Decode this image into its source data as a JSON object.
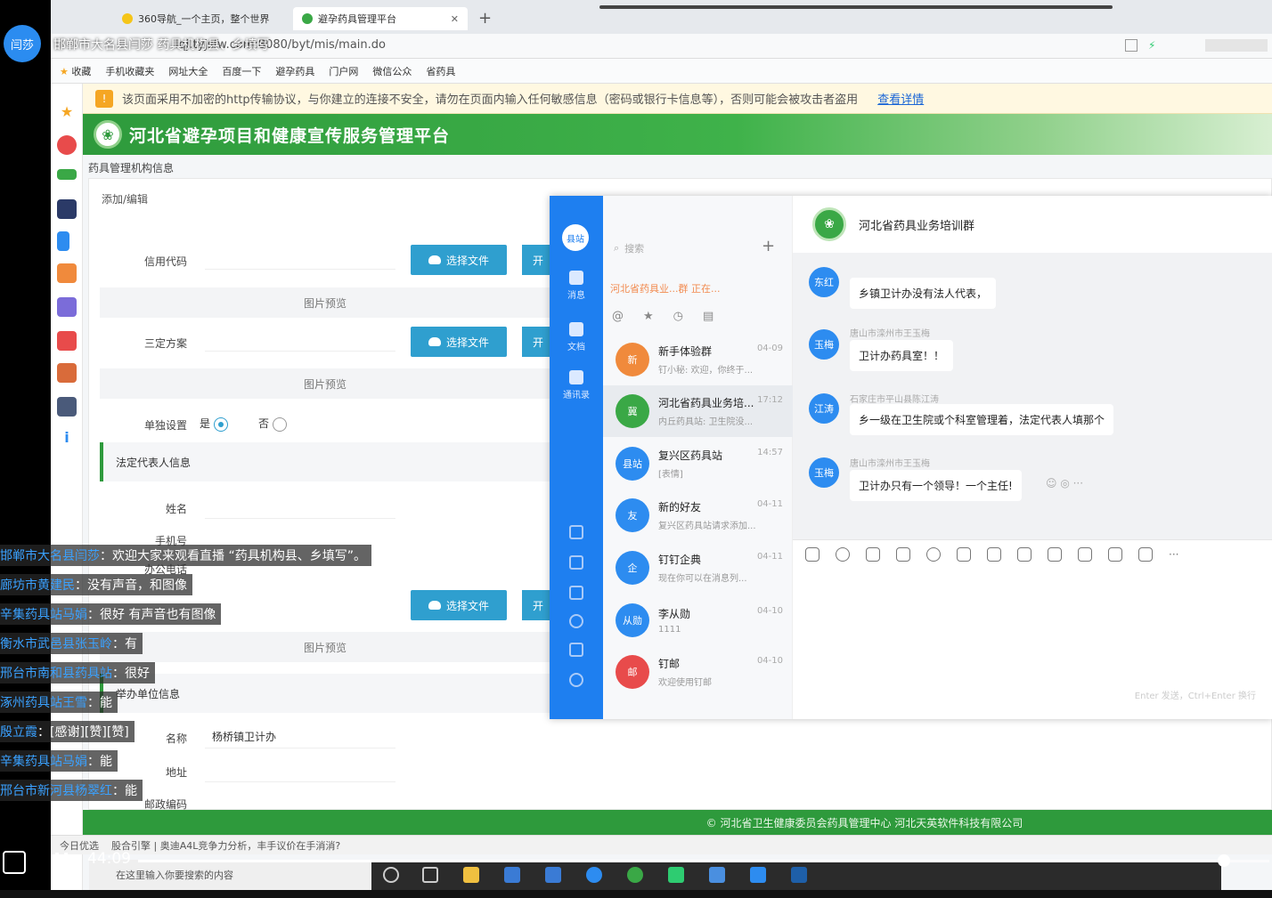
{
  "live": {
    "host_avatar": "闫莎",
    "title_overlay": "邯郸市大名县闫莎 药具机构县、乡填写",
    "time": "44:09",
    "progress": 0.96,
    "comments": [
      {
        "user": "邯郸市大名县闫莎",
        "text": "欢迎大家来观看直播 “药具机构县、乡填写”。"
      },
      {
        "user": "廊坊市黄建民",
        "text": "没有声音，和图像"
      },
      {
        "user": "辛集药具站马娟",
        "text": "很好 有声音也有图像"
      },
      {
        "user": "衡水市武邑县张玉岭",
        "text": "有"
      },
      {
        "user": "邢台市南和县药具站",
        "text": "很好"
      },
      {
        "user": "涿州药具站王雪",
        "text": "能"
      },
      {
        "user": "殷立霞",
        "text": "[感谢][赞][赞]"
      },
      {
        "user": "辛集药具站马娟",
        "text": "能"
      },
      {
        "user": "邢台市新河县杨翠红",
        "text": "能"
      }
    ]
  },
  "browser": {
    "tabs": [
      "360导航_一个主页，整个世界",
      "避孕药具管理平台"
    ],
    "url": "lqj.tyjsfw.com:8080/byt/mis/main.do",
    "bookmarks": [
      "收藏",
      "手机收藏夹",
      "网址大全",
      "百度一下",
      "避孕药具",
      "门户网",
      "微信公众",
      "省药具"
    ]
  },
  "warning": {
    "text": "该页面采用不加密的http传输协议，与你建立的连接不安全，请勿在页面内输入任何敏感信息（密码或银行卡信息等），否则可能会被攻击者盗用",
    "link": "查看详情"
  },
  "site": {
    "title": "河北省避孕项目和健康宣传服务管理平台",
    "breadcrumb": "药具管理机构信息",
    "subtitle": "添加/编辑",
    "footer": "© 河北省卫生健康委员会药具管理中心    河北天英软件科技有限公司"
  },
  "form": {
    "credit_code_label": "信用代码",
    "choose_file": "选择文件",
    "open_btn": "开",
    "image_preview": "图片预览",
    "sanding_label": "三定方案",
    "standalone_label": "单独设置",
    "yes": "是",
    "no": "否",
    "legal_section": "法定代表人信息",
    "name_label": "姓名",
    "phone_label": "手机号",
    "office_label": "办公电话",
    "host_section": "举办单位信息",
    "org_name_label": "名称",
    "org_name_value": "杨桥镇卫计办",
    "address_label": "地址",
    "postcode_label": "邮政编码"
  },
  "dingtalk": {
    "nav_avatar": "县站",
    "nav_items": [
      "消息",
      "文档",
      "通讯录"
    ],
    "search_placeholder": "搜索",
    "pinned": "河北省药具业...群 正在...",
    "conversations": [
      {
        "avatar": "新",
        "name": "新手体验群",
        "time": "04-09",
        "preview": "钉小秘: 欢迎，你终于...",
        "color": "#f08a3c"
      },
      {
        "avatar": "冀",
        "name": "河北省药具业务培...",
        "time": "17:12",
        "preview": "内丘药具站: 卫生院没...",
        "color": "#3aa846"
      },
      {
        "avatar": "县站",
        "name": "复兴区药具站",
        "time": "14:57",
        "preview": "[表情]",
        "color": "#2d8cf0"
      },
      {
        "avatar": "友",
        "name": "新的好友",
        "time": "04-11",
        "preview": "复兴区药具站请求添加...",
        "color": "#2d8cf0"
      },
      {
        "avatar": "企",
        "name": "钉钉企典",
        "time": "04-11",
        "preview": "现在你可以在消息列...",
        "color": "#2d8cf0"
      },
      {
        "avatar": "从勋",
        "name": "李从勋",
        "time": "04-10",
        "preview": "1111",
        "color": "#2d8cf0"
      },
      {
        "avatar": "邮",
        "name": "钉邮",
        "time": "04-10",
        "preview": "欢迎使用钉邮",
        "color": "#e84b4b"
      }
    ],
    "chat_title": "河北省药具业务培训群",
    "messages": [
      {
        "avatar": "东红",
        "sender": "",
        "text": "乡镇卫计办没有法人代表，"
      },
      {
        "avatar": "玉梅",
        "sender": "唐山市滦州市王玉梅",
        "text": "卫计办药具室！！"
      },
      {
        "avatar": "江涛",
        "sender": "石家庄市平山县陈江涛",
        "text": "乡一级在卫生院或个科室管理着，法定代表人填那个"
      },
      {
        "avatar": "玉梅",
        "sender": "唐山市滦州市王玉梅",
        "text": "卫计办只有一个领导！一个主任!"
      }
    ],
    "send_hint": "Enter 发送，Ctrl+Enter 换行"
  },
  "taskbar": {
    "search_placeholder": "在这里输入你要搜索的内容",
    "ticker": [
      "今日优选",
      "股合引擎 | 奥迪A4L竞争力分析，丰手议价在手消消?"
    ]
  }
}
